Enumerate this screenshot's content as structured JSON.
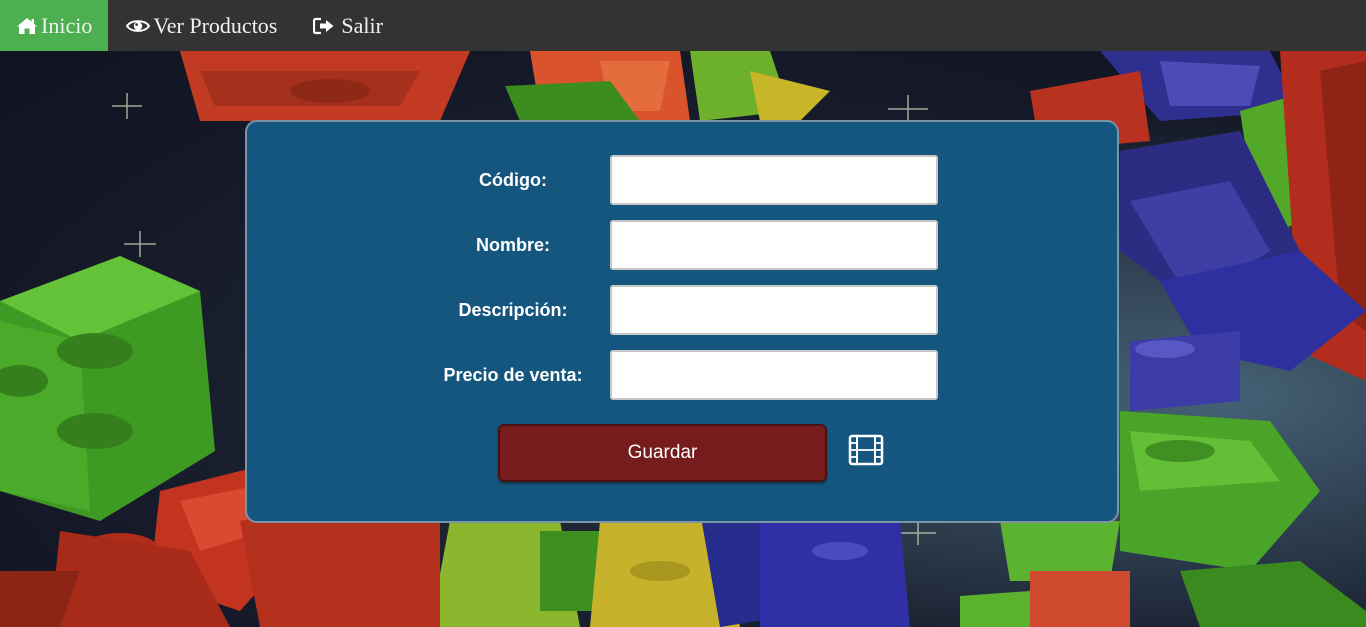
{
  "nav": {
    "items": [
      {
        "label": "Inicio",
        "icon": "home-icon",
        "active": true
      },
      {
        "label": "Ver Productos",
        "icon": "eye-icon",
        "active": false
      },
      {
        "label": "Salir",
        "icon": "sign-out-icon",
        "active": false
      }
    ]
  },
  "form": {
    "fields": [
      {
        "label": "Código:",
        "value": ""
      },
      {
        "label": "Nombre:",
        "value": ""
      },
      {
        "label": "Descripción:",
        "value": ""
      },
      {
        "label": "Precio de venta:",
        "value": ""
      }
    ],
    "save_label": "Guardar",
    "media_icon": "film-icon"
  },
  "colors": {
    "nav_bg": "#333333",
    "nav_active": "#4caf50",
    "card_bg": "#15567f",
    "save_button": "#761c1c"
  }
}
